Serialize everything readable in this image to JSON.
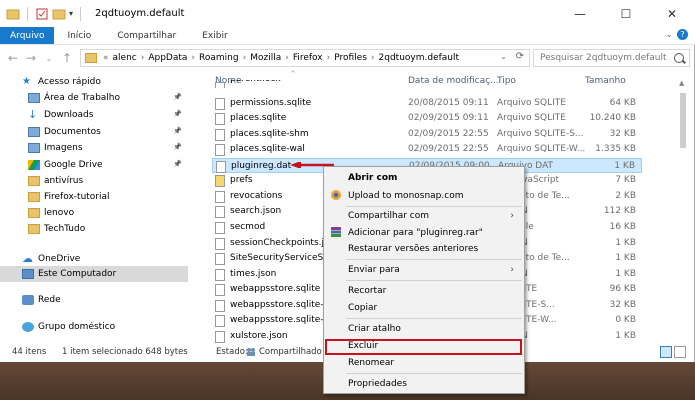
{
  "window": {
    "title": "2qdtuoym.default",
    "controls": {
      "minimize": "—",
      "maximize": "☐",
      "close": "✕"
    }
  },
  "ribbon": {
    "tabs": [
      "Arquivo",
      "Início",
      "Compartilhar",
      "Exibir"
    ]
  },
  "address": {
    "prefix": "«",
    "crumbs": [
      "alenc",
      "AppData",
      "Roaming",
      "Mozilla",
      "Firefox",
      "Profiles",
      "2qdtuoym.default"
    ],
    "search_placeholder": "Pesquisar 2qdtuoym.default"
  },
  "sidebar": {
    "items": [
      {
        "label": "Acesso rápido",
        "icon": "star-icon",
        "pinned": false
      },
      {
        "label": "Área de Trabalho",
        "icon": "desktop-icon",
        "pinned": true
      },
      {
        "label": "Downloads",
        "icon": "download-icon",
        "pinned": true
      },
      {
        "label": "Documentos",
        "icon": "documents-icon",
        "pinned": true
      },
      {
        "label": "Imagens",
        "icon": "pictures-icon",
        "pinned": true
      },
      {
        "label": "Google Drive",
        "icon": "google-drive-icon",
        "pinned": true
      },
      {
        "label": "antivírus",
        "icon": "folder-icon",
        "pinned": false
      },
      {
        "label": "Firefox-tutorial",
        "icon": "folder-icon",
        "pinned": false
      },
      {
        "label": "lenovo",
        "icon": "folder-icon",
        "pinned": false
      },
      {
        "label": "TechTudo",
        "icon": "folder-icon",
        "pinned": false
      },
      {
        "label": "OneDrive",
        "icon": "cloud-icon",
        "pinned": false
      },
      {
        "label": "Este Computador",
        "icon": "computer-icon",
        "pinned": false
      },
      {
        "label": "Rede",
        "icon": "network-icon",
        "pinned": false
      },
      {
        "label": "Grupo doméstico",
        "icon": "homegroup-icon",
        "pinned": false
      }
    ]
  },
  "columns": {
    "name": "Nome",
    "date": "Data de modificaç...",
    "type": "Tipo",
    "size": "Tamanho"
  },
  "files": [
    {
      "name": "parent.lock",
      "date": "",
      "type": "",
      "size": ""
    },
    {
      "name": "permissions.sqlite",
      "date": "20/08/2015 09:11",
      "type": "Arquivo SQLITE",
      "size": "64 KB"
    },
    {
      "name": "places.sqlite",
      "date": "02/09/2015 09:11",
      "type": "Arquivo SQLITE",
      "size": "10.240 KB"
    },
    {
      "name": "places.sqlite-shm",
      "date": "02/09/2015 22:55",
      "type": "Arquivo SQLITE-S...",
      "size": "32 KB"
    },
    {
      "name": "places.sqlite-wal",
      "date": "02/09/2015 22:55",
      "type": "Arquivo SQLITE-W...",
      "size": "1.335 KB"
    },
    {
      "name": "pluginreg.dat",
      "date": "02/09/2015 09:00",
      "type": "Arquivo DAT",
      "size": "1 KB"
    },
    {
      "name": "prefs",
      "date": "",
      "type": "...o JavaScript",
      "size": "7 KB"
    },
    {
      "name": "revocations",
      "date": "",
      "type": "...mento de Te...",
      "size": "2 KB"
    },
    {
      "name": "search.json",
      "date": "",
      "type": "...JSON",
      "size": "112 KB"
    },
    {
      "name": "secmod",
      "date": "",
      "type": "...se File",
      "size": "16 KB"
    },
    {
      "name": "sessionCheckpoints.json",
      "date": "",
      "type": "...JSON",
      "size": "1 KB"
    },
    {
      "name": "SiteSecurityServiceState",
      "date": "",
      "type": "...mento de Te...",
      "size": "1 KB"
    },
    {
      "name": "times.json",
      "date": "",
      "type": "...JSON",
      "size": "1 KB"
    },
    {
      "name": "webappsstore.sqlite",
      "date": "",
      "type": "...SQLITE",
      "size": "96 KB"
    },
    {
      "name": "webappsstore.sqlite-shm",
      "date": "",
      "type": "...SQLITE-S...",
      "size": "32 KB"
    },
    {
      "name": "webappsstore.sqlite-wal",
      "date": "",
      "type": "...SQLITE-W...",
      "size": "0 KB"
    },
    {
      "name": "xulstore.json",
      "date": "",
      "type": "...JSON",
      "size": "1 KB"
    }
  ],
  "status": {
    "count": "44 itens",
    "selected": "1 item selecionado  648 bytes",
    "state_label": "Estado:",
    "state_value": "Compartilhado"
  },
  "context_menu": {
    "items": [
      "Abrir com",
      "Upload to monosnap.com",
      "Compartilhar com",
      "Adicionar para \"pluginreg.rar\"",
      "Restaurar versões anteriores",
      "Enviar para",
      "Recortar",
      "Copiar",
      "Criar atalho",
      "Excluir",
      "Renomear",
      "Propriedades"
    ]
  },
  "colors": {
    "accent": "#1979ca",
    "selection": "#cce8ff",
    "highlight": "#c8131f"
  }
}
